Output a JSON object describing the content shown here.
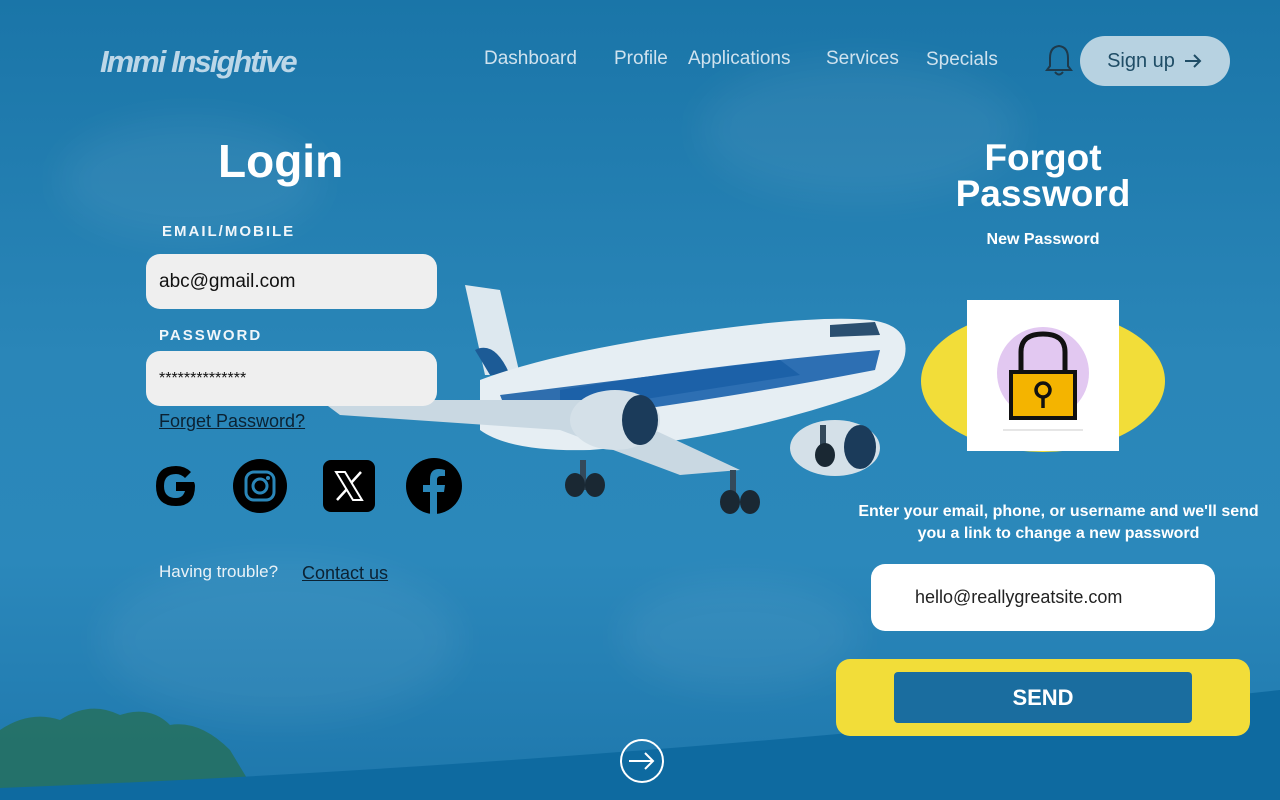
{
  "header": {
    "logo": "Immi Insightive",
    "nav": [
      "Dashboard",
      "Profile",
      "Applications",
      "Services",
      "Specials"
    ],
    "signup_label": "Sign up"
  },
  "login": {
    "title": "Login",
    "email_label": "EMAIL/MOBILE",
    "email_value": "abc@gmail.com",
    "password_label": "PASSWORD",
    "password_value": "**************",
    "forget_link": "Forget Password?",
    "social": [
      "google-icon",
      "instagram-icon",
      "x-icon",
      "facebook-icon"
    ],
    "trouble_text": "Having trouble?",
    "contact_link": "Contact us"
  },
  "forgot": {
    "title_line1": "Forgot",
    "title_line2": "Password",
    "subtitle": "New Password",
    "description": "Enter your email, phone, or username and we'll send you a link to change a new password",
    "input_value": "hello@reallygreatsite.com",
    "send_label": "SEND"
  },
  "colors": {
    "background": "#1a75a8",
    "accent_yellow": "#f2dd39",
    "send_button": "#1a6d9f",
    "signup_button": "#b7d2e1"
  }
}
